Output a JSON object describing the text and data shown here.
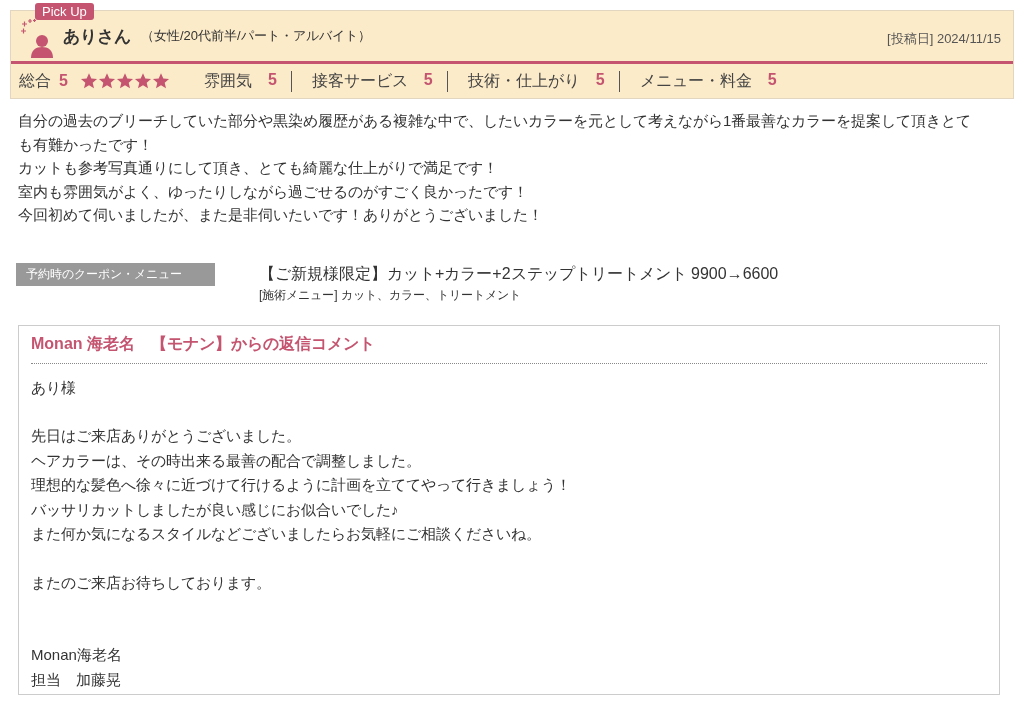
{
  "review": {
    "badge": "Pick Up",
    "reviewer_name": "ありさん",
    "reviewer_profile": "（女性/20代前半/パート・アルバイト）",
    "posted_date": "[投稿日] 2024/11/15",
    "overall": {
      "label": "総合",
      "score": "5",
      "stars": 5
    },
    "ratings": [
      {
        "label": "雰囲気",
        "score": "5"
      },
      {
        "label": "接客サービス",
        "score": "5"
      },
      {
        "label": "技術・仕上がり",
        "score": "5"
      },
      {
        "label": "メニュー・料金",
        "score": "5"
      }
    ],
    "body": [
      "自分の過去のブリーチしていた部分や黒染め履歴がある複雑な中で、したいカラーを元として考えながら1番最善なカラーを提案して頂きとても有難かったです！",
      "カットも参考写真通りにして頂き、とても綺麗な仕上がりで満足です！",
      "室内も雰囲気がよく、ゆったりしながら過ごせるのがすごく良かったです！",
      "今回初めて伺いましたが、また是非伺いたいです！ありがとうございました！"
    ],
    "coupon": {
      "label": "予約時のクーポン・メニュー",
      "name": "【ご新規様限定】カット+カラー+2ステップトリートメント 9900→6600",
      "menu": "[施術メニュー] カット、カラー、トリートメント"
    }
  },
  "reply": {
    "title": "Monan 海老名　【モナン】からの返信コメント",
    "paragraphs": [
      [
        "あり様"
      ],
      [
        "先日はご来店ありがとうございました。",
        "ヘアカラーは、その時出来る最善の配合で調整しました。",
        "理想的な髪色へ徐々に近づけて行けるように計画を立ててやって行きましょう！",
        "バッサリカットしましたが良い感じにお似合いでした♪",
        "また何か気になるスタイルなどございましたらお気軽にご相談くださいね。"
      ],
      [
        "またのご来店お待ちしております。"
      ],
      [
        "Monan海老名",
        "担当　加藤晃"
      ]
    ]
  }
}
